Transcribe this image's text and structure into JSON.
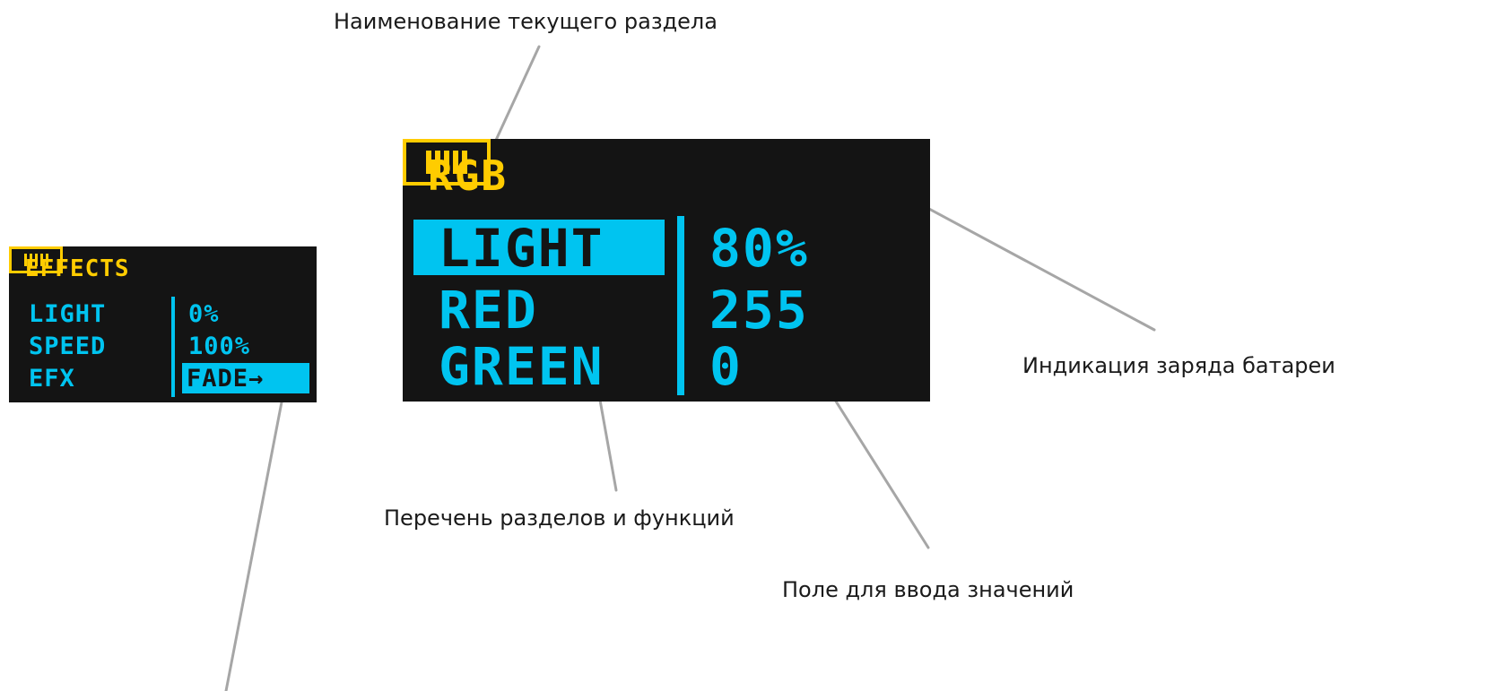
{
  "annotations": {
    "section_name": "Наименование текущего раздела",
    "battery": "Индикация заряда батареи",
    "menu_list": "Перечень разделов и функций",
    "value_field": "Поле для ввода значений"
  },
  "main_screen": {
    "title": "RGB",
    "battery_bars": 5,
    "items": [
      "LIGHT",
      "RED",
      "GREEN"
    ],
    "values": [
      "80%",
      "255",
      "0"
    ],
    "selected_item": "LIGHT"
  },
  "effects_screen": {
    "title": "EFFECTS",
    "battery_bars": 5,
    "items": [
      "LIGHT",
      "SPEED",
      "EFX"
    ],
    "values": [
      "0%",
      "100%",
      "FADE→"
    ],
    "selected_value": "FADE→"
  },
  "colors": {
    "accent_yellow": "#ffcc00",
    "accent_cyan": "#00c4f0",
    "screen_bg": "#141414",
    "leader_line": "#a6a6a6"
  }
}
